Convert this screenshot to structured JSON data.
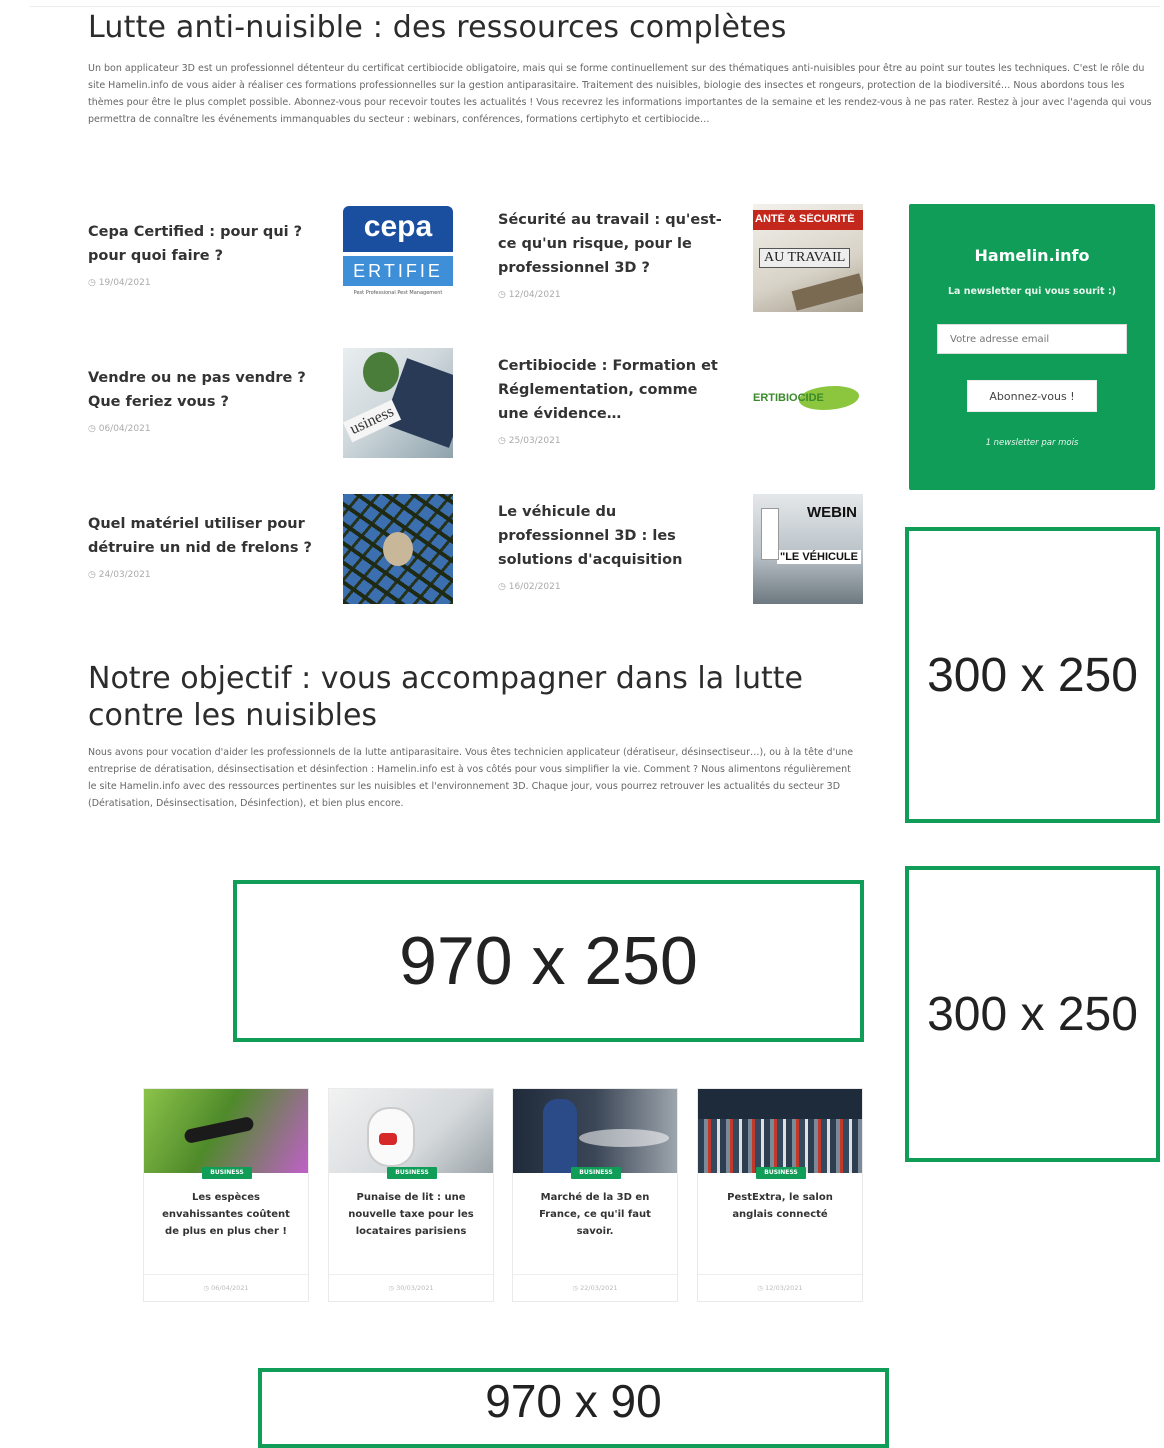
{
  "hero": {
    "title": "Lutte anti-nuisible : des ressources complètes",
    "text": "Un bon applicateur 3D est un professionnel détenteur du certificat certibiocide obligatoire, mais qui se forme continuellement sur des thématiques anti-nuisibles pour être au point sur toutes les techniques. C'est le rôle du site Hamelin.info de vous aider à réaliser ces formations professionnelles sur la gestion antiparasitaire. Traitement des nuisibles, biologie des insectes et rongeurs, protection de la biodiversité… Nous abordons tous les thèmes pour être le plus complet possible. Abonnez-vous pour recevoir toutes les actualités ! Vous recevrez les informations importantes de la semaine et les rendez-vous à ne pas rater. Restez à jour avec l'agenda qui vous permettra de connaître les événements immanquables du secteur : webinars, conférences, formations certiphyto et certibiocide…"
  },
  "articles": [
    {
      "title": "Cepa Certified : pour qui ? pour quoi faire ?",
      "date": "◷ 19/04/2021",
      "thumb_text": "cepa"
    },
    {
      "title": "Sécurité au travail : qu'est-ce qu'un risque, pour le professionnel 3D ?",
      "date": "◷ 12/04/2021",
      "thumb_text": "ANTÉ & SÉCURITÉ"
    },
    {
      "title": "Vendre ou ne pas vendre ? Que feriez vous ?",
      "date": "◷ 06/04/2021",
      "thumb_text": "usiness"
    },
    {
      "title": "Certibiocide : Formation et Réglementation, comme une évidence…",
      "date": "◷ 25/03/2021",
      "thumb_text": "ERTIBIOCIDE"
    },
    {
      "title": "Quel matériel utiliser pour détruire un nid de frelons ?",
      "date": "◷ 24/03/2021",
      "thumb_text": ""
    },
    {
      "title": "Le véhicule du professionnel 3D : les solutions d'acquisition",
      "date": "◷ 16/02/2021",
      "thumb_text": "WEBIN"
    }
  ],
  "thumbs": {
    "cepa_sub": "ERTIFIE",
    "cepa_small": "Pest Professional Pest Management",
    "safety_sub": "AU TRAVAIL",
    "webin_sub": "\"LE VÉHICULE"
  },
  "newsletter": {
    "title": "Hamelin.info",
    "subtitle": "La newsletter qui vous sourit :)",
    "placeholder": "Votre adresse email",
    "button": "Abonnez-vous !",
    "note": "1 newsletter par mois",
    "color": "#0f9d58"
  },
  "objective": {
    "title": "Notre objectif : vous accompagner dans la lutte contre les nuisibles",
    "text": "Nous avons pour vocation d'aider les professionnels de la lutte antiparasitaire. Vous êtes technicien applicateur (dératiseur, désinsectiseur…), ou à la tête d'une entreprise de dératisation, désinsectisation et désinfection : Hamelin.info est à vos côtés pour vous simplifier la vie. Comment ? Nous alimentons régulièrement le site Hamelin.info avec des ressources pertinentes sur les nuisibles et l'environnement 3D. Chaque jour, vous pourrez retrouver les actualités du secteur 3D (Dératisation, Désinsectisation, Désinfection), et bien plus encore."
  },
  "ads": {
    "side1": "300 x 250",
    "side2": "300 x 250",
    "billboard": "970 x 250",
    "leaderboard": "970 x 90"
  },
  "cards": [
    {
      "badge": "BUSINESS",
      "title": "Les espèces envahissantes coûtent de plus en plus cher !",
      "date": "◷ 06/04/2021"
    },
    {
      "badge": "BUSINESS",
      "title": "Punaise de lit : une nouvelle taxe pour les locataires parisiens",
      "date": "◷ 30/03/2021"
    },
    {
      "badge": "BUSINESS",
      "title": "Marché de la 3D en France, ce qu'il faut savoir.",
      "date": "◷ 22/03/2021"
    },
    {
      "badge": "BUSINESS",
      "title": "PestExtra, le salon anglais connecté",
      "date": "◷ 12/03/2021"
    }
  ]
}
